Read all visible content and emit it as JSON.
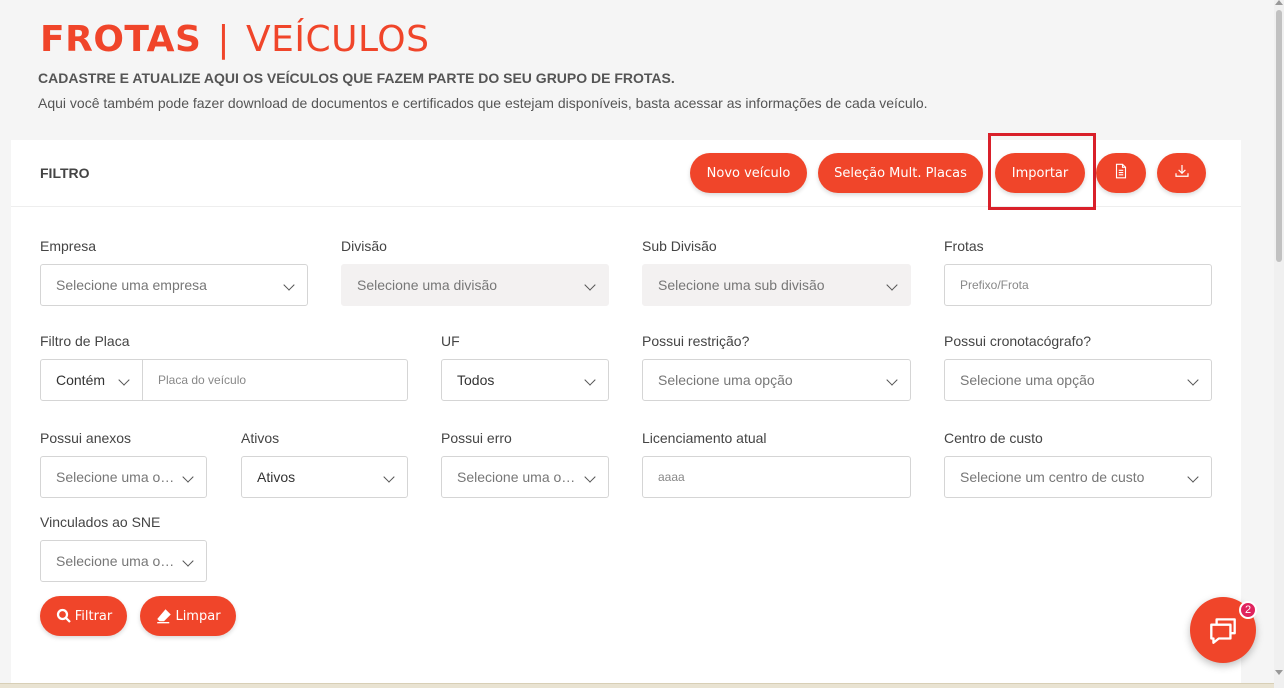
{
  "header": {
    "title_main": "FROTAS",
    "title_sep": "|",
    "title_sub": "VEÍCULOS",
    "subtitle": "CADASTRE E ATUALIZE AQUI OS VEÍCULOS QUE FAZEM PARTE DO SEU GRUPO DE FROTAS.",
    "description": "Aqui você também pode fazer download de documentos e certificados que estejam disponíveis, basta acessar as informações de cada veículo."
  },
  "filter": {
    "title": "FILTRO",
    "buttons": {
      "new_vehicle": "Novo veículo",
      "multi_select": "Seleção Mult. Placas",
      "import": "Importar",
      "report_icon": "document-icon",
      "download_icon": "download-icon"
    },
    "fields": {
      "empresa": {
        "label": "Empresa",
        "placeholder": "Selecione uma empresa"
      },
      "divisao": {
        "label": "Divisão",
        "placeholder": "Selecione uma divisão"
      },
      "subdivisao": {
        "label": "Sub Divisão",
        "placeholder": "Selecione uma sub divisão"
      },
      "frotas": {
        "label": "Frotas",
        "placeholder": "Prefixo/Frota"
      },
      "placa": {
        "label": "Filtro de Placa",
        "mode": "Contém",
        "placeholder": "Placa do veículo"
      },
      "uf": {
        "label": "UF",
        "value": "Todos"
      },
      "restricao": {
        "label": "Possui restrição?",
        "placeholder": "Selecione uma opção"
      },
      "cronotacografo": {
        "label": "Possui cronotacógrafo?",
        "placeholder": "Selecione uma opção"
      },
      "anexos": {
        "label": "Possui anexos",
        "placeholder": "Selecione uma opção"
      },
      "ativos": {
        "label": "Ativos",
        "value": "Ativos"
      },
      "erro": {
        "label": "Possui erro",
        "placeholder": "Selecione uma opção"
      },
      "licenciamento": {
        "label": "Licenciamento atual",
        "placeholder": "aaaa"
      },
      "centro_custo": {
        "label": "Centro de custo",
        "placeholder": "Selecione um centro de custo"
      },
      "sne": {
        "label": "Vinculados ao SNE",
        "placeholder": "Selecione uma opção"
      }
    },
    "actions": {
      "filter": "Filtrar",
      "clear": "Limpar"
    }
  },
  "chat": {
    "badge_count": "2",
    "icon": "chat-icon"
  },
  "colors": {
    "accent": "#f0452a",
    "highlight": "#d9202a"
  }
}
